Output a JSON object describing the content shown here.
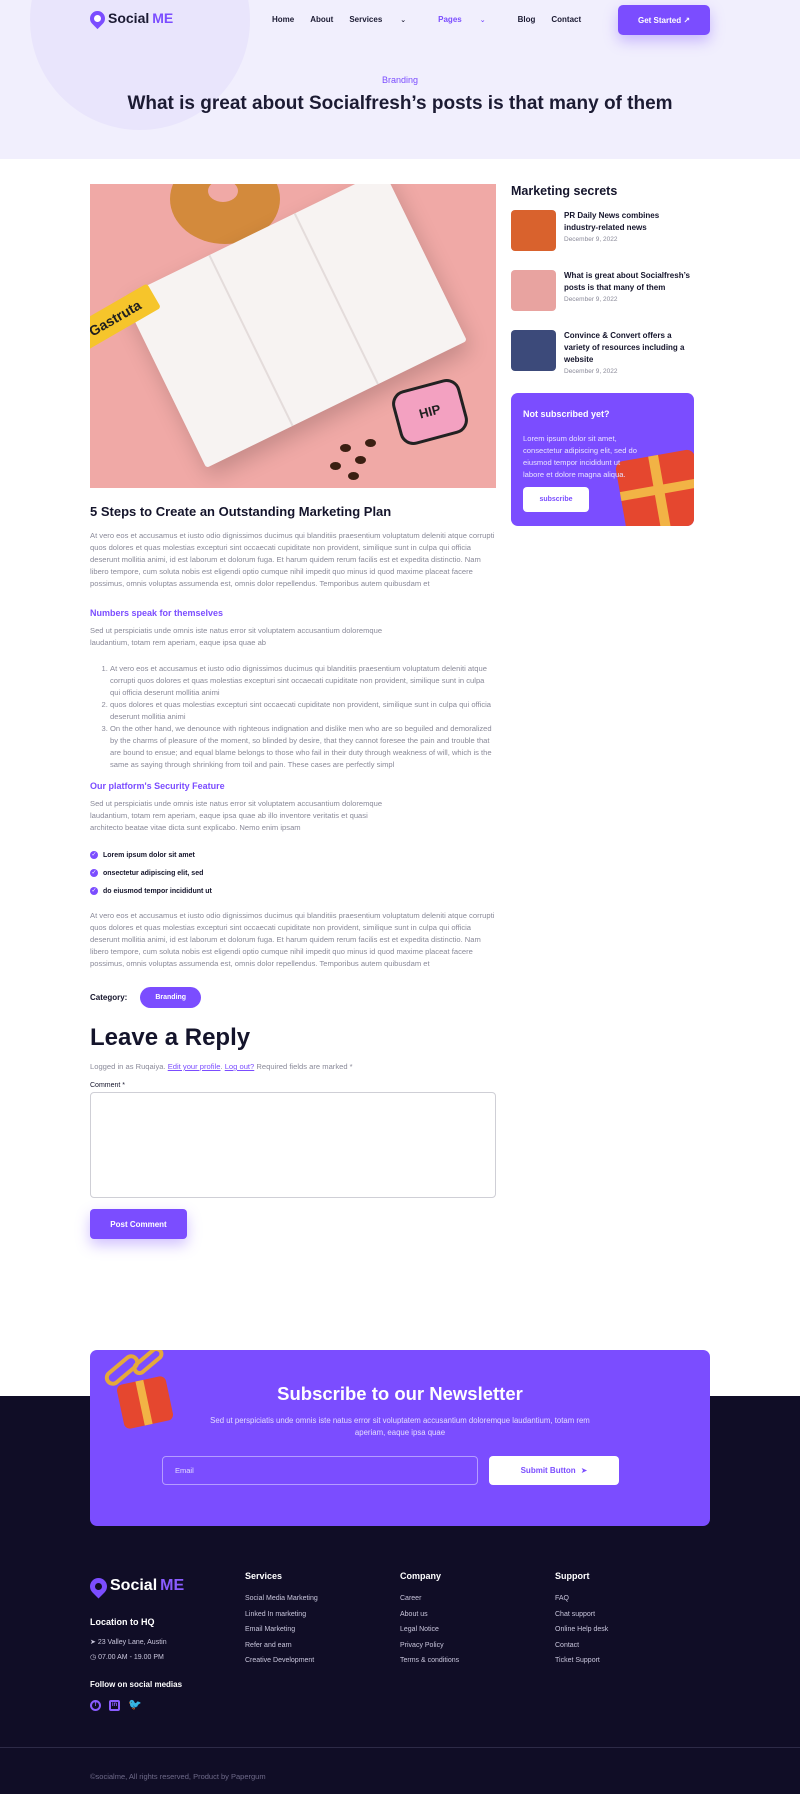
{
  "brand": {
    "name_prefix": "Social",
    "name_suffix": "ME"
  },
  "nav": {
    "items": [
      "Home",
      "About",
      "Services",
      "Pages",
      "Blog",
      "Contact"
    ],
    "cta": "Get Started"
  },
  "hero": {
    "category": "Branding",
    "title": "What is great about Socialfresh’s posts is that many of them"
  },
  "article": {
    "title": "5 Steps to Create an Outstanding Marketing Plan",
    "intro": "At vero eos et accusamus et iusto odio dignissimos ducimus qui blanditiis praesentium voluptatum deleniti atque corrupti quos dolores et quas molestias excepturi sint occaecati cupiditate non provident, similique sunt in culpa qui officia deserunt mollitia animi, id est laborum et dolorum fuga. Et harum quidem rerum facilis est et expedita distinctio. Nam libero tempore, cum soluta nobis est eligendi optio cumque nihil impedit quo minus id quod maxime placeat facere possimus, omnis voluptas assumenda est, omnis dolor repellendus. Temporibus autem quibusdam et",
    "section1": {
      "heading": "Numbers speak for themselves",
      "text": "Sed ut perspiciatis unde omnis iste natus error sit voluptatem accusantium doloremque laudantium, totam rem aperiam, eaque ipsa quae ab",
      "list": [
        "At vero eos et accusamus et iusto odio dignissimos ducimus qui blanditiis praesentium voluptatum deleniti atque corrupti quos dolores et quas molestias excepturi sint occaecati cupiditate non provident, similique sunt in culpa qui officia deserunt mollitia animi",
        "quos dolores et quas molestias excepturi sint occaecati cupiditate non provident, similique sunt in culpa qui officia deserunt mollitia animi",
        "On the other hand, we denounce with righteous indignation and dislike men who are so beguiled and demoralized by the charms of pleasure of the moment, so blinded by desire, that they cannot foresee the pain and trouble that are bound to ensue; and equal blame belongs to those who fail in their duty through weakness of will, which is the same as saying through shrinking from toil and pain. These cases are perfectly simpl"
      ]
    },
    "section2": {
      "heading": "Our platform's Security Feature",
      "text": "Sed ut perspiciatis unde omnis iste natus error sit voluptatem accusantium doloremque laudantium, totam rem aperiam, eaque ipsa quae ab illo inventore veritatis et quasi architecto beatae vitae dicta sunt explicabo. Nemo enim ipsam",
      "checks": [
        "Lorem ipsum dolor sit amet",
        "onsectetur adipiscing elit, sed",
        "do eiusmod tempor incididunt ut"
      ]
    },
    "outro": "At vero eos et accusamus et iusto odio dignissimos ducimus qui blanditiis praesentium voluptatum deleniti atque corrupti quos dolores et quas molestias excepturi sint occaecati cupiditate non provident, similique sunt in culpa qui officia deserunt mollitia animi, id est laborum et dolorum fuga. Et harum quidem rerum facilis est et expedita distinctio. Nam libero tempore, cum soluta nobis est eligendi optio cumque nihil impedit quo minus id quod maxime placeat facere possimus, omnis voluptas assumenda est, omnis dolor repellendus. Temporibus autem quibusdam et",
    "category_label": "Category:",
    "category_value": "Branding",
    "featured_sticker": "Gastruta",
    "featured_hand": "HIP"
  },
  "reply": {
    "title": "Leave a Reply",
    "logged_prefix": "Logged in as Ruqaiya.",
    "edit_link": "Edit your profile",
    "logout_link": "Log out?",
    "required_note": "Required fields are marked *",
    "comment_label": "Comment *",
    "submit": "Post Comment"
  },
  "sidebar": {
    "title": "Marketing secrets",
    "posts": [
      {
        "title": "PR Daily News combines industry-related news",
        "date": "December 9, 2022",
        "thumb_color": "#d9622d"
      },
      {
        "title": "What is great about Socialfresh’s posts is that many of them",
        "date": "December 9, 2022",
        "thumb_color": "#e8a3a0"
      },
      {
        "title": "Convince & Convert offers a variety of resources including a website",
        "date": "December 9, 2022",
        "thumb_color": "#3c4a7a"
      }
    ],
    "promo": {
      "title": "Not subscribed yet?",
      "text": "Lorem ipsum dolor sit amet, consectetur adipiscing elit, sed do eiusmod tempor incididunt ut labore et dolore magna aliqua.",
      "button": "subscribe"
    }
  },
  "newsletter": {
    "title": "Subscribe to our Newsletter",
    "text": "Sed ut perspiciatis unde omnis iste natus error sit voluptatem accusantium doloremque laudantium, totam rem aperiam, eaque ipsa quae",
    "placeholder": "Email",
    "button": "Submit Button"
  },
  "footer": {
    "location_title": "Location to HQ",
    "address": "23 Valley Lane, Austin",
    "hours": "07.00 AM - 19.00 PM",
    "follow": "Follow on social medias",
    "columns": [
      {
        "title": "Services",
        "items": [
          "Social Media Marketing",
          "Linked In marketing",
          "Email Marketing",
          "Refer and earn",
          "Creative Development"
        ]
      },
      {
        "title": "Company",
        "items": [
          "Career",
          "About us",
          "Legal Notice",
          "Privacy Policy",
          "Terms & conditions"
        ]
      },
      {
        "title": "Support",
        "items": [
          "FAQ",
          "Chat support",
          "Online Help desk",
          "Contact",
          "Ticket Support"
        ]
      }
    ],
    "copyright": "©socialme, All rights reserved, Product by Papergum"
  },
  "colors": {
    "accent": "#7b4dff",
    "footer_bg": "#100d26",
    "hero_bg": "#f1effd"
  }
}
